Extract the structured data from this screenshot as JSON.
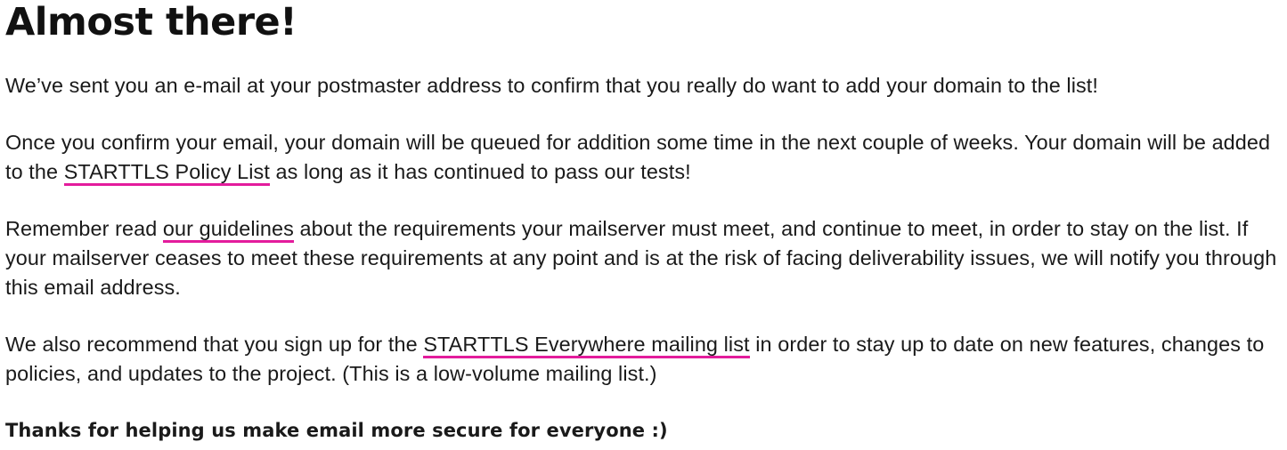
{
  "heading": "Almost there!",
  "para1": "We’ve sent you an e-mail at your postmaster address to confirm that you really do want to add your domain to the list!",
  "para2": {
    "before": "Once you confirm your email, your domain will be queued for addition some time in the next couple of weeks. Your domain will be added to the ",
    "link": "STARTTLS Policy List",
    "after": " as long as it has continued to pass our tests!"
  },
  "para3": {
    "before": "Remember read ",
    "link": "our guidelines",
    "after": " about the requirements your mailserver must meet, and continue to meet, in order to stay on the list. If your mailserver ceases to meet these requirements at any point and is at the risk of facing deliverability issues, we will notify you through this email address."
  },
  "para4": {
    "before": "We also recommend that you sign up for the ",
    "link": "STARTTLS Everywhere mailing list",
    "after": " in order to stay up to date on new features, changes to policies, and updates to the project. (This is a low-volume mailing list.)"
  },
  "thanks": "Thanks for helping us make email more secure for everyone :)",
  "colors": {
    "link_underline": "#e31c9c",
    "text": "#1a1a1a"
  }
}
